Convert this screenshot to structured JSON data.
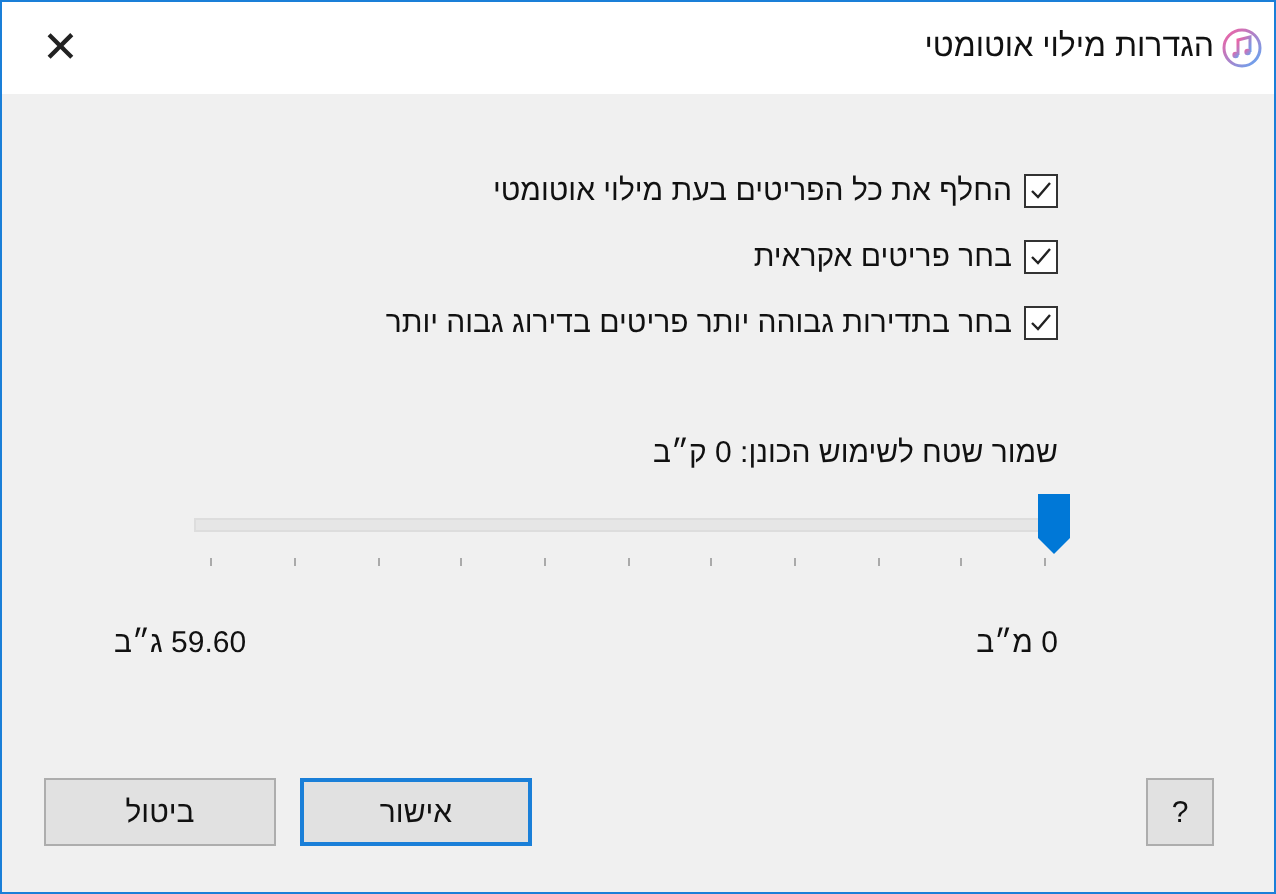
{
  "window": {
    "title": "הגדרות מילוי אוטומטי",
    "close": "✕"
  },
  "options": [
    {
      "label": "החלף את כל הפריטים בעת מילוי אוטומטי",
      "checked": true
    },
    {
      "label": "בחר פריטים אקראית",
      "checked": true
    },
    {
      "label": "בחר בתדירות גבוהה יותר פריטים בדירוג גבוה יותר",
      "checked": true
    }
  ],
  "space": {
    "label": "שמור שטח לשימוש הכונן: 0 ק״ב",
    "level": 0,
    "min_label": "0 מ״ב",
    "max_label": "59.60 ג״ב"
  },
  "buttons": [
    {
      "kind": "help",
      "label": "?",
      "default": false
    },
    {
      "kind": "ok",
      "label": "אישור",
      "default": true
    },
    {
      "kind": "cancel",
      "label": "ביטול",
      "default": false
    }
  ]
}
